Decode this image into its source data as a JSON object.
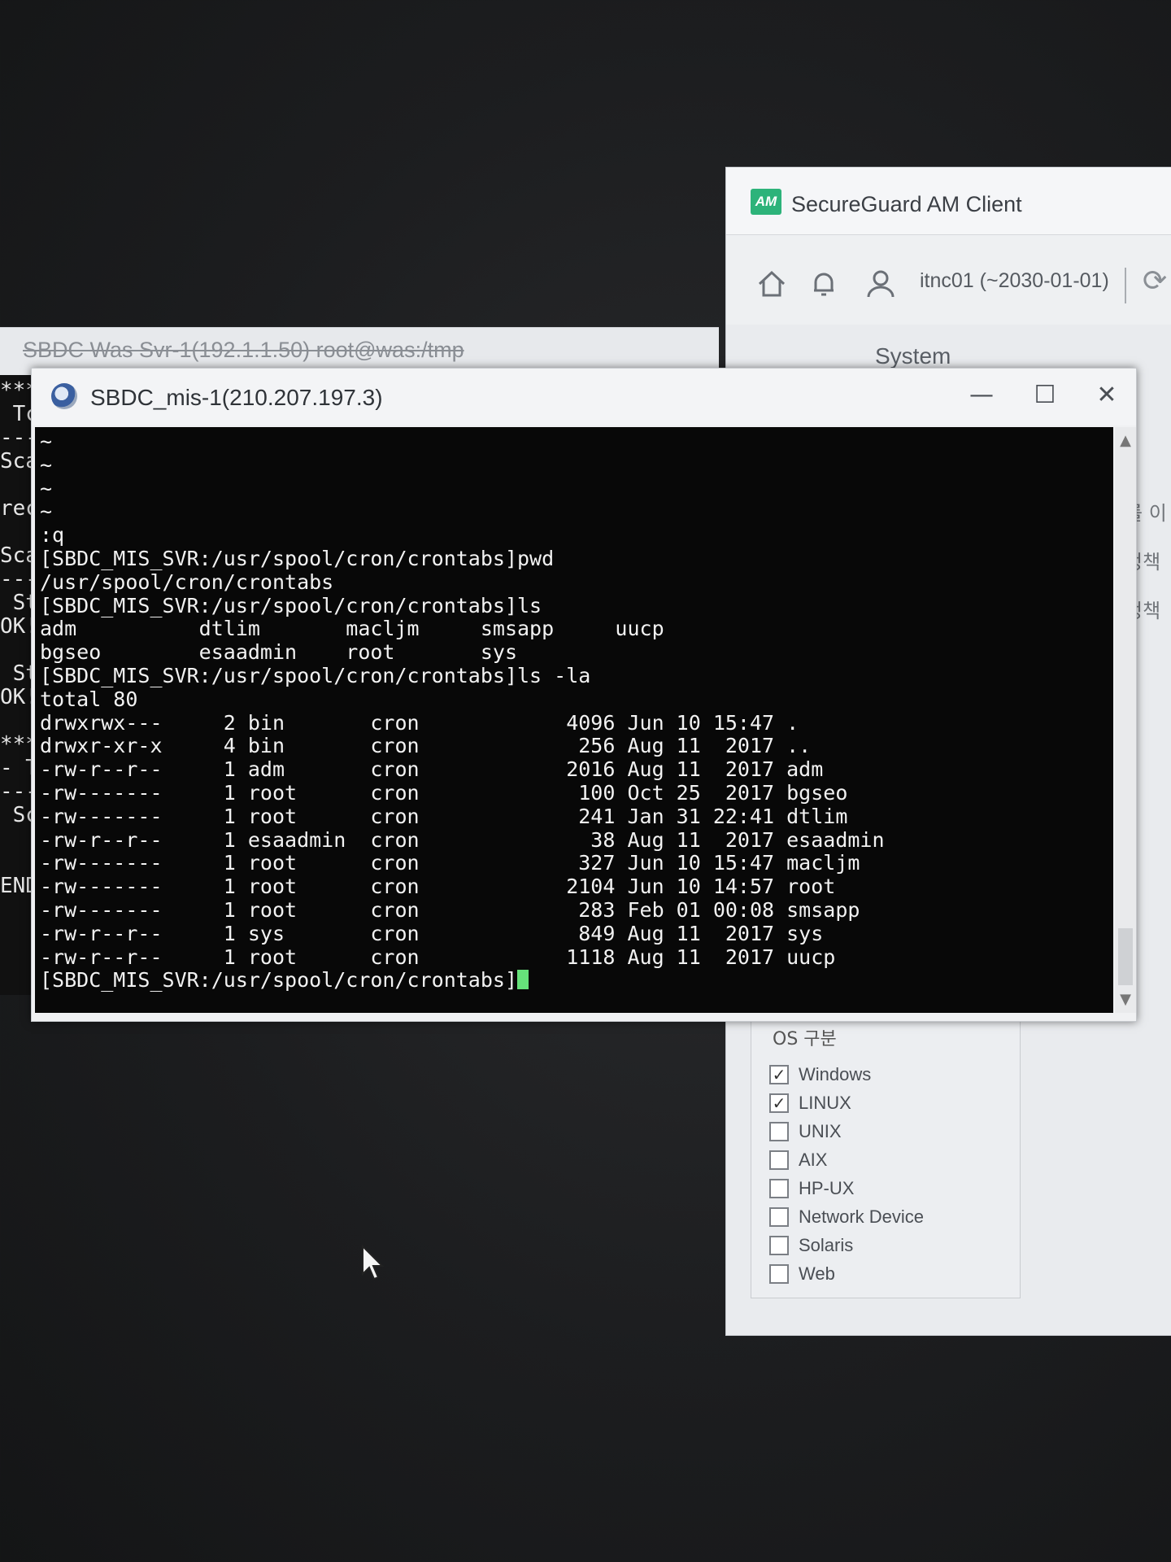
{
  "secureguard": {
    "app_title": "SecureGuard AM Client",
    "logo_text": "AM",
    "user": "itnc01 (~2030-01-01)",
    "section": "System",
    "side_items": [
      "를 이",
      "정책",
      "정책"
    ],
    "os_panel": {
      "header": "OS 구분",
      "options": [
        {
          "label": "Windows",
          "checked": true
        },
        {
          "label": "LINUX",
          "checked": true
        },
        {
          "label": "UNIX",
          "checked": false
        },
        {
          "label": "AIX",
          "checked": false
        },
        {
          "label": "HP-UX",
          "checked": false
        },
        {
          "label": "Network Device",
          "checked": false
        },
        {
          "label": "Solaris",
          "checked": false
        },
        {
          "label": "Web",
          "checked": false
        }
      ]
    }
  },
  "background_window": {
    "title": "SBDC Was Svr-1(192.1.1.50) root@was:/tmp",
    "left_fragments": [
      "***",
      " Tc",
      "---",
      "Sca",
      "",
      "rec",
      "",
      "Sca",
      "---",
      " Sta",
      "OK!",
      "",
      " Sta",
      "OK!",
      "",
      "****",
      "- Tc",
      "----",
      " Sca",
      "",
      "",
      "END E"
    ]
  },
  "main_window": {
    "title": "SBDC_mis-1(210.207.197.3)",
    "controls": {
      "minimize": "—",
      "maximize": "☐",
      "close": "✕"
    },
    "terminal_lines": [
      "~",
      "~",
      "~",
      "~",
      ":q",
      "[SBDC_MIS_SVR:/usr/spool/cron/crontabs]pwd",
      "/usr/spool/cron/crontabs",
      "[SBDC_MIS_SVR:/usr/spool/cron/crontabs]ls",
      "adm          dtlim       macljm     smsapp     uucp",
      "bgseo        esaadmin    root       sys",
      "[SBDC_MIS_SVR:/usr/spool/cron/crontabs]ls -la",
      "total 80",
      "drwxrwx---     2 bin       cron            4096 Jun 10 15:47 .",
      "drwxr-xr-x     4 bin       cron             256 Aug 11  2017 ..",
      "-rw-r--r--     1 adm       cron            2016 Aug 11  2017 adm",
      "-rw-------     1 root      cron             100 Oct 25  2017 bgseo",
      "-rw-------     1 root      cron             241 Jan 31 22:41 dtlim",
      "-rw-r--r--     1 esaadmin  cron              38 Aug 11  2017 esaadmin",
      "-rw-------     1 root      cron             327 Jun 10 15:47 macljm",
      "-rw-------     1 root      cron            2104 Jun 10 14:57 root",
      "-rw-------     1 root      cron             283 Feb 01 00:08 smsapp",
      "-rw-r--r--     1 sys       cron             849 Aug 11  2017 sys",
      "-rw-r--r--     1 root      cron            1118 Aug 11  2017 uucp"
    ],
    "prompt": "[SBDC_MIS_SVR:/usr/spool/cron/crontabs]"
  },
  "colors": {
    "cursor": "#66e27a",
    "logo": "#2db37a",
    "terminal_bg": "#080808"
  }
}
